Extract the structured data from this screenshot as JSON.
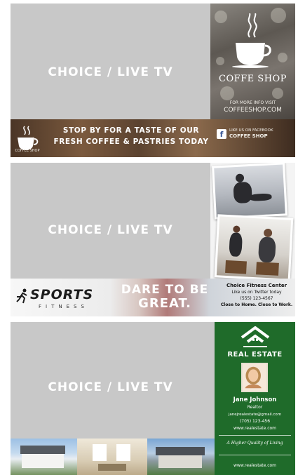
{
  "panels": [
    {
      "tv_label": "CHOICE / LIVE TV",
      "ad": {
        "shop_name": "COFFE SHOP",
        "tag_line1": "FOR MORE INFO VISIT",
        "tag_line2": "COFFEESHOP.COM",
        "logo_caption": "COFFEE SHOP",
        "message_line1": "STOP BY FOR A TASTE OF OUR",
        "message_line2": "FRESH COFFEE & PASTRIES TODAY",
        "social_icon": "facebook-icon",
        "social_text": "LIKE US ON FACEBOOK",
        "social_name": "COFFEE SHOP"
      }
    },
    {
      "tv_label": "CHOICE / LIVE TV",
      "ad": {
        "brand": "SPORTS",
        "brand_sub": "FITNESS",
        "slogan_line1": "DARE TO BE",
        "slogan_line2": "GREAT.",
        "center_name": "Choice Fitness Center",
        "center_line1": "Like us on Twitter today",
        "center_phone": "(555) 123-4567",
        "center_slogan": "Close to Home. Close to Work."
      }
    },
    {
      "tv_label": "CHOICE / LIVE TV",
      "ad": {
        "title": "REAL ESTATE",
        "agent_name": "Jane Johnson",
        "agent_role": "Realtor",
        "email": "janejrealestate@gmail.com",
        "phone": "(705) 123-456",
        "website": "www.realestate.com",
        "quality": "A Higher Quality of Living",
        "website_footer": "www.realestate.com"
      }
    }
  ],
  "colors": {
    "screen_gray": "#c8c8c8",
    "real_estate_green": "#1f6b2a",
    "coffee_brown": "#5c4330"
  }
}
